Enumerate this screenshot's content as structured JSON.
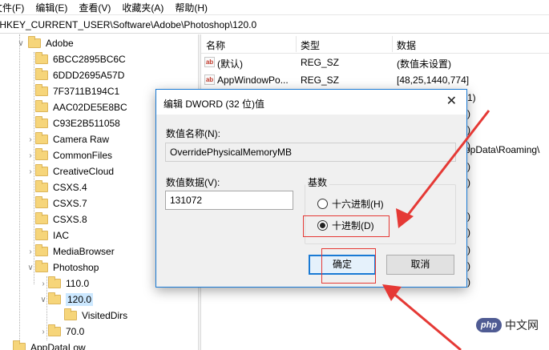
{
  "menu": [
    "文件(F)",
    "编辑(E)",
    "查看(V)",
    "收藏夹(A)",
    "帮助(H)"
  ],
  "address": "\\HKEY_CURRENT_USER\\Software\\Adobe\\Photoshop\\120.0",
  "tree": [
    {
      "label": "Adobe",
      "expanded": true
    },
    {
      "label": "6BCC2895BC6C"
    },
    {
      "label": "6DDD2695A57D"
    },
    {
      "label": "7F3711B194C1"
    },
    {
      "label": "AAC02DE5E8BC"
    },
    {
      "label": "C93E2B511058"
    },
    {
      "label": "Camera Raw"
    },
    {
      "label": "CommonFiles"
    },
    {
      "label": "CreativeCloud"
    },
    {
      "label": "CSXS.4"
    },
    {
      "label": "CSXS.7"
    },
    {
      "label": "CSXS.8"
    },
    {
      "label": "IAC"
    },
    {
      "label": "MediaBrowser"
    },
    {
      "label": "Photoshop",
      "expanded": true
    },
    {
      "label": "110.0"
    },
    {
      "label": "120.0",
      "expanded": true,
      "selected": true
    },
    {
      "label": "VisitedDirs"
    },
    {
      "label": "70.0"
    },
    {
      "label": "AppDataLow"
    }
  ],
  "values_header": {
    "name": "名称",
    "type": "类型",
    "data": "数据"
  },
  "values": [
    {
      "name": "(默认)",
      "type": "REG_SZ",
      "data": "(数值未设置)"
    },
    {
      "name": "AppWindowPo...",
      "type": "REG_SZ",
      "data": "[48,25,1440,774]"
    }
  ],
  "values_right_fragments": [
    "1)",
    ")",
    ")",
    ")",
    "ppData\\Roaming\\",
    ")",
    ")",
    ")",
    ")",
    ")",
    ")",
    ")"
  ],
  "dialog": {
    "title": "编辑 DWORD (32 位)值",
    "value_name_label": "数值名称(N):",
    "value_name": "OverridePhysicalMemoryMB",
    "value_data_label": "数值数据(V):",
    "value_data": "131072",
    "base_label": "基数",
    "radio_hex": "十六进制(H)",
    "radio_dec": "十进制(D)",
    "selected_base": "dec",
    "ok": "确定",
    "cancel": "取消"
  },
  "watermark": {
    "logo": "php",
    "text": "中文网"
  },
  "colors": {
    "annotation_red": "#e53935",
    "accent_blue": "#1a7ad4",
    "folder_yellow": "#f6d57a"
  }
}
